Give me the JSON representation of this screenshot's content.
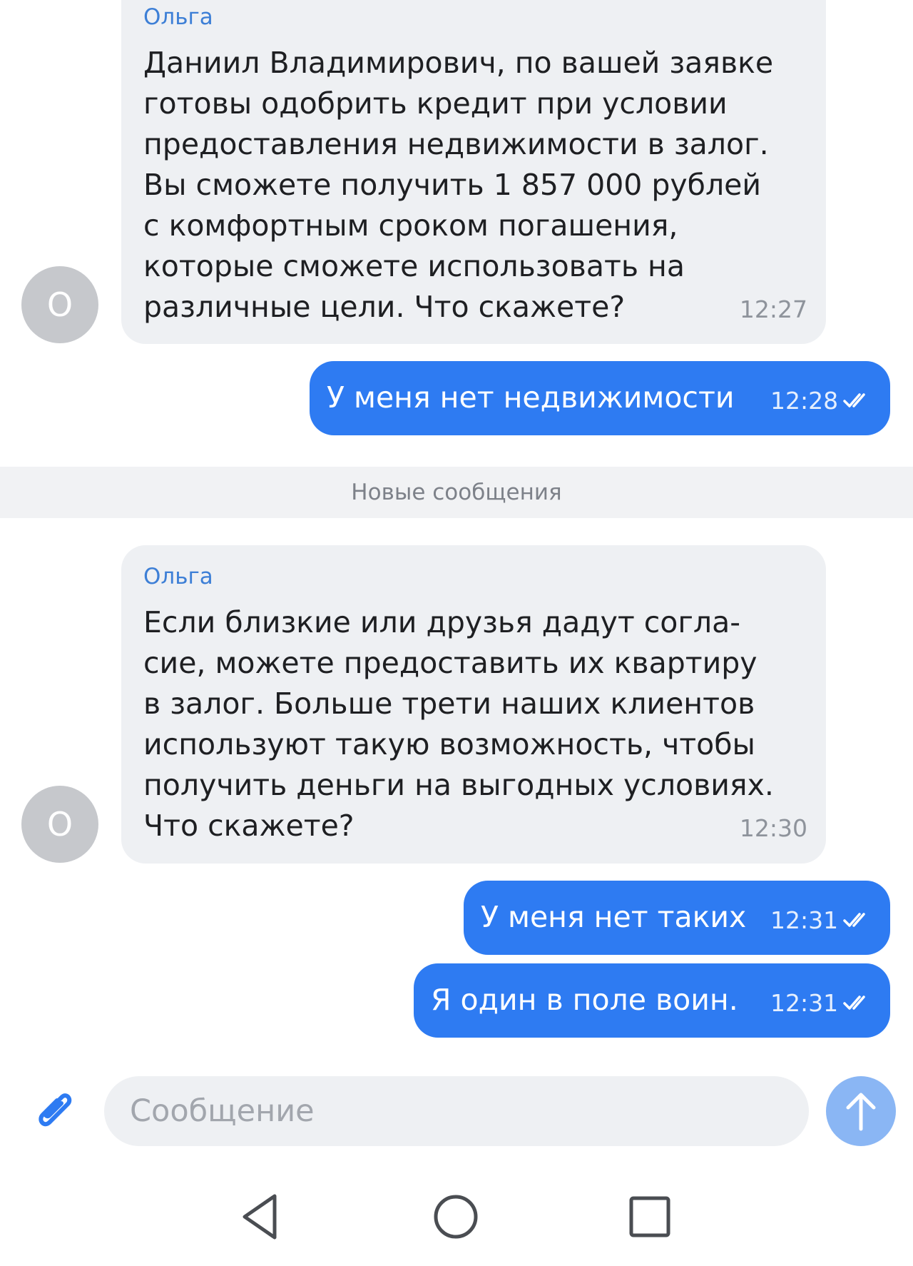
{
  "messages": [
    {
      "type": "incoming",
      "sender": "Ольга",
      "avatar_initial": "О",
      "lines": [
        "Даниил Владимирович, по вашей заявке",
        "готовы одобрить кредит при условии",
        "предоставления недвижимости в залог.",
        "Вы сможете получить 1 857 000 рублей",
        "с комфортным сроком погашения,",
        "которые сможете использовать на",
        "различные цели. Что скажете?"
      ],
      "time": "12:27"
    },
    {
      "type": "outgoing",
      "text": "У меня нет недвижимости",
      "time": "12:28",
      "read": true
    },
    {
      "type": "incoming",
      "sender": "Ольга",
      "avatar_initial": "О",
      "lines": [
        "Если близкие или друзья дадут согла-",
        "сие, можете предоставить их квартиру",
        "в залог. Больше трети наших клиентов",
        "используют такую возможность, чтобы",
        "получить деньги на выгодных условиях.",
        "Что скажете?"
      ],
      "time": "12:30"
    },
    {
      "type": "outgoing",
      "text": "У меня нет таких",
      "time": "12:31",
      "read": true
    },
    {
      "type": "outgoing",
      "text": "Я один в поле воин.",
      "time": "12:31",
      "read": true
    }
  ],
  "divider": {
    "label": "Новые сообщения"
  },
  "composer": {
    "placeholder": "Сообщение",
    "value": ""
  },
  "icons": {
    "attach": "paperclip-icon",
    "send": "arrow-up-icon",
    "check": "double-check-icon",
    "nav_back": "triangle-back-icon",
    "nav_home": "circle-home-icon",
    "nav_recents": "square-recents-icon"
  },
  "colors": {
    "outgoing_bubble": "#2e7bf2",
    "incoming_bubble": "#eef0f3",
    "sender_name": "#3d7fd6",
    "avatar": "#c6c8cc",
    "send_button": "#8ab6f4"
  }
}
